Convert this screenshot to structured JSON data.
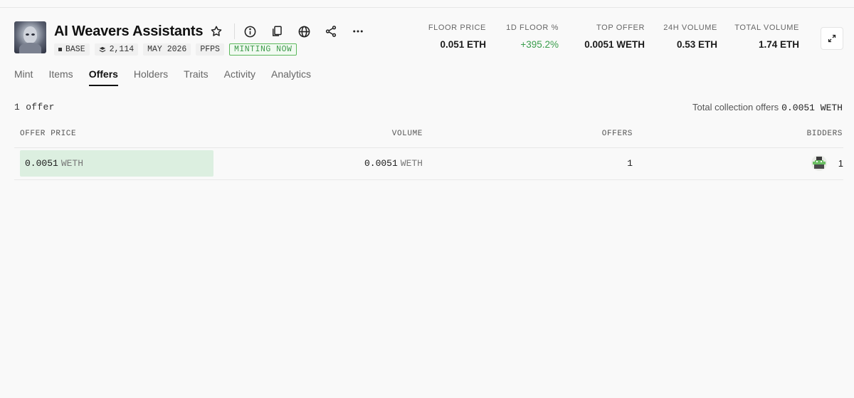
{
  "collection": {
    "title": "AI Weavers Assistants",
    "chain": "BASE",
    "items_count": "2,114",
    "date": "MAY 2026",
    "category": "PFPS",
    "status": "MINTING NOW"
  },
  "actions": [
    {
      "icon": "star-icon"
    },
    {
      "icon": "info-icon"
    },
    {
      "icon": "copy-icon"
    },
    {
      "icon": "globe-icon"
    },
    {
      "icon": "share-icon"
    },
    {
      "icon": "more-icon"
    }
  ],
  "stats": [
    {
      "label": "FLOOR PRICE",
      "value": "0.051 ETH"
    },
    {
      "label": "1D FLOOR %",
      "value": "+395.2%"
    },
    {
      "label": "TOP OFFER",
      "value": "0.0051 WETH"
    },
    {
      "label": "24H VOLUME",
      "value": "0.53 ETH"
    },
    {
      "label": "TOTAL VOLUME",
      "value": "1.74 ETH"
    }
  ],
  "tabs": [
    "Mint",
    "Items",
    "Offers",
    "Holders",
    "Traits",
    "Activity",
    "Analytics"
  ],
  "active_tab": "Offers",
  "offers": {
    "count_text": "1 offer",
    "total_label": "Total collection offers",
    "total_value": "0.0051 WETH",
    "columns": [
      "OFFER PRICE",
      "VOLUME",
      "OFFERS",
      "BIDDERS"
    ],
    "rows": [
      {
        "price": "0.0051",
        "price_unit": "WETH",
        "volume": "0.0051",
        "volume_unit": "WETH",
        "offers": "1",
        "bidders": "1"
      }
    ]
  },
  "colors": {
    "positive": "#3a9d4c",
    "minting_border": "#5cb85c",
    "offer_bar": "#dcefe0"
  }
}
